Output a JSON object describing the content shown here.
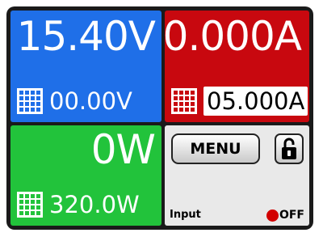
{
  "colors": {
    "voltage_bg": "#1f6fe8",
    "current_bg": "#c8080f",
    "power_bg": "#22c33b",
    "control_bg": "#e9e9e9",
    "frame": "#1a1a1a",
    "status_off": "#d20000"
  },
  "voltage": {
    "actual": "15.40V",
    "set": "00.00V",
    "icon": "grid-icon"
  },
  "current": {
    "actual": "0.000A",
    "set": "05.000A",
    "icon": "grid-icon"
  },
  "power": {
    "actual": "0W",
    "set": "320.0W",
    "icon": "grid-icon"
  },
  "control": {
    "menu_label": "MENU",
    "lock_icon": "unlocked-padlock-icon",
    "input_label": "Input",
    "status_text": "OFF",
    "status_icon": "red-dot-icon"
  }
}
